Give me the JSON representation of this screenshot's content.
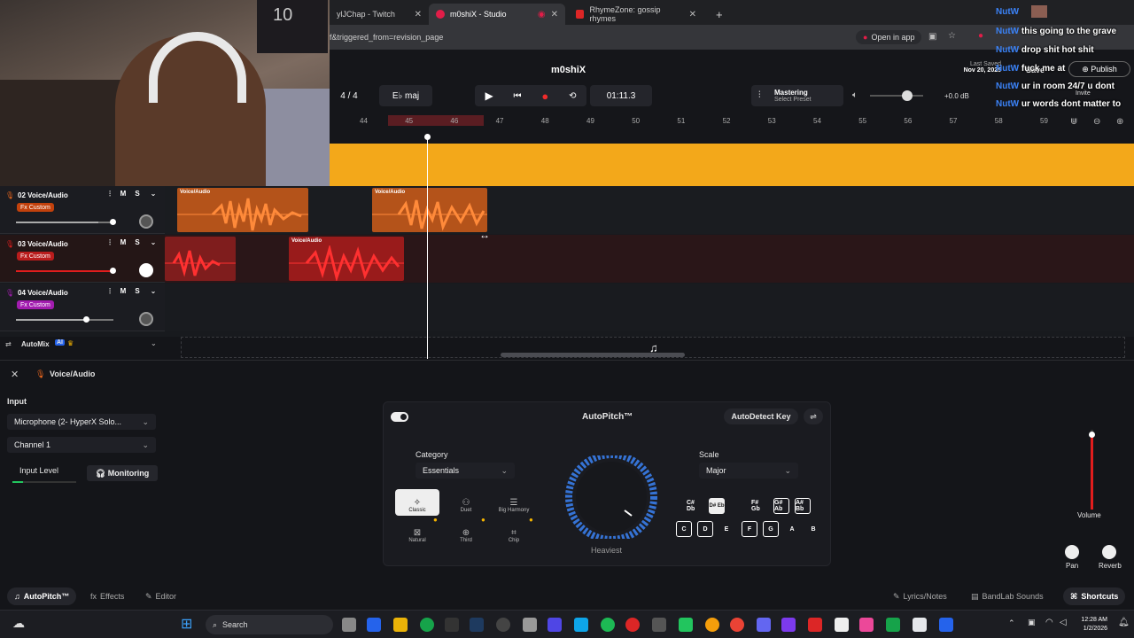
{
  "browser": {
    "tabs": [
      {
        "label": "ylJChap - Twitch",
        "color": "#9146ff"
      },
      {
        "label": "m0shiX - Studio",
        "color": "#e11d48"
      },
      {
        "label": "RhymeZone: gossip rhymes",
        "color": "#dc2626"
      }
    ],
    "url": "f&triggered_from=revision_page",
    "open_in_app": "Open in app"
  },
  "webcam": {
    "shirt_number": "10"
  },
  "studio": {
    "project_name": "m0shiX",
    "last_saved_label": "Last Saved",
    "last_saved_date": "Nov 20, 2025",
    "save_label": "Save",
    "publish_label": "Publish",
    "invite_label": "Invite",
    "time_signature": "4 / 4",
    "key": "E♭ maj",
    "time": "01:11.3",
    "mastering_title": "Mastering",
    "mastering_sub": "Select Preset",
    "volume_db": "+0.0 dB",
    "ruler_ticks": [
      "44",
      "45",
      "46",
      "47",
      "48",
      "49",
      "50",
      "51",
      "52",
      "53",
      "54",
      "55",
      "56",
      "57",
      "58",
      "59"
    ],
    "tracks": [
      {
        "name": "02  Voice/Audio",
        "fx": "Fx Custom",
        "color": "#e8651c",
        "fxbg": "#c2410c",
        "volume": 0.85
      },
      {
        "name": "03  Voice/Audio",
        "fx": "Fx Custom",
        "color": "#e11d1d",
        "fxbg": "#b91c1c",
        "volume": 0.85
      },
      {
        "name": "04  Voice/Audio",
        "fx": "Fx Custom",
        "color": "#a21caf",
        "fxbg": "#a21caf",
        "volume": 0.6
      }
    ],
    "clip_label": "Voice/Audio",
    "mute_label": "M",
    "solo_label": "S",
    "automix": "AutoMix",
    "ai_badge": "AI"
  },
  "panel": {
    "title": "Voice/Audio",
    "input_label": "Input",
    "input_device": "Microphone (2- HyperX Solo...",
    "channel": "Channel 1",
    "input_level": "Input Level",
    "monitoring": "Monitoring",
    "autopitch_title": "AutoPitch™",
    "autodetect": "AutoDetect Key",
    "category_label": "Category",
    "category_value": "Essentials",
    "presets": [
      "Classic",
      "Duet",
      "Big Harmony",
      "Natural",
      "Third",
      "Chip"
    ],
    "heaviest": "Heaviest",
    "scale_label": "Scale",
    "scale_value": "Major",
    "keys_natural": [
      "C",
      "D",
      "E",
      "F",
      "G",
      "A",
      "B"
    ],
    "keys_sharp": [
      "C# Db",
      "D# Eb",
      "F# Gb",
      "G# Ab",
      "A# Bb"
    ],
    "volume_label": "Volume",
    "pan_label": "Pan",
    "reverb_label": "Reverb"
  },
  "footer": {
    "autopitch": "AutoPitch™",
    "effects": "Effects",
    "editor": "Editor",
    "lyrics": "Lyrics/Notes",
    "sounds": "BandLab Sounds",
    "shortcuts": "Shortcuts"
  },
  "chat": [
    {
      "user": "NutW",
      "msg": ""
    },
    {
      "user": "NutW",
      "msg": "this going to the grave"
    },
    {
      "user": "NutW",
      "msg": "drop shit hot shit"
    },
    {
      "user": "NutW",
      "msg": "fuck me  at"
    },
    {
      "user": "NutW",
      "msg": "ur in room 24/7 u dont"
    },
    {
      "user": "NutW",
      "msg": "ur words dont matter to"
    }
  ],
  "taskbar": {
    "search": "Search",
    "time": "12:28 AM",
    "date": "1/2/2026"
  }
}
